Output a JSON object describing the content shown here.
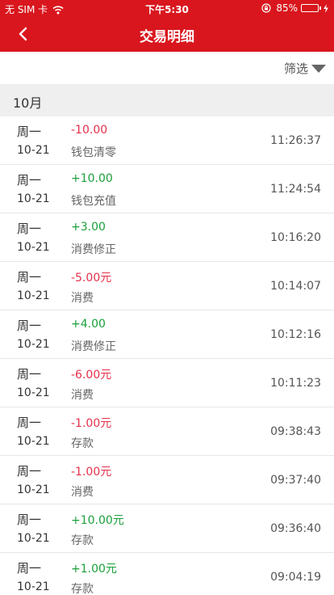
{
  "status_bar": {
    "carrier": "无 SIM 卡",
    "time": "下午5:30",
    "battery": "85%",
    "battery_level": 0.85
  },
  "nav": {
    "title": "交易明细"
  },
  "filter": {
    "label": "筛选"
  },
  "month": "10月",
  "colors": {
    "brand": "#d9161d",
    "negative": "#e5304a",
    "positive": "#1aa03a"
  },
  "transactions": [
    {
      "weekday": "周一",
      "date": "10-21",
      "amount": "-10.00",
      "type": "negative",
      "desc": "钱包清零",
      "time": "11:26:37"
    },
    {
      "weekday": "周一",
      "date": "10-21",
      "amount": "+10.00",
      "type": "positive",
      "desc": "钱包充值",
      "time": "11:24:54"
    },
    {
      "weekday": "周一",
      "date": "10-21",
      "amount": "+3.00",
      "type": "positive",
      "desc": "消费修正",
      "time": "10:16:20"
    },
    {
      "weekday": "周一",
      "date": "10-21",
      "amount": "-5.00元",
      "type": "negative",
      "desc": "消费",
      "time": "10:14:07"
    },
    {
      "weekday": "周一",
      "date": "10-21",
      "amount": "+4.00",
      "type": "positive",
      "desc": "消费修正",
      "time": "10:12:16"
    },
    {
      "weekday": "周一",
      "date": "10-21",
      "amount": "-6.00元",
      "type": "negative",
      "desc": "消费",
      "time": "10:11:23"
    },
    {
      "weekday": "周一",
      "date": "10-21",
      "amount": "-1.00元",
      "type": "negative",
      "desc": "存款",
      "time": "09:38:43"
    },
    {
      "weekday": "周一",
      "date": "10-21",
      "amount": "-1.00元",
      "type": "negative",
      "desc": "消费",
      "time": "09:37:40"
    },
    {
      "weekday": "周一",
      "date": "10-21",
      "amount": "+10.00元",
      "type": "positive",
      "desc": "存款",
      "time": "09:36:40"
    },
    {
      "weekday": "周一",
      "date": "10-21",
      "amount": "+1.00元",
      "type": "positive",
      "desc": "存款",
      "time": "09:04:19"
    }
  ]
}
